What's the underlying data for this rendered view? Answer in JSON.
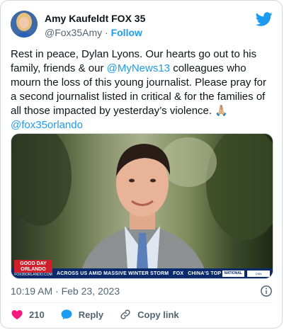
{
  "author": {
    "display_name": "Amy Kaufeldt FOX 35",
    "handle": "@Fox35Amy",
    "separator": "·",
    "follow_label": "Follow"
  },
  "tweet": {
    "text_part1": "Rest in peace, Dylan Lyons. Our hearts go out to his family, friends & our ",
    "mention1": "@MyNews13",
    "text_part2": " colleagues who mourn the loss of this young journalist. Please pray for a second journalist listed in critical & for the families of all those impacted by yesterday’s violence. 🙏🏼  ",
    "mention2": "@fox35orlando"
  },
  "media": {
    "badge_line1": "GOOD DAY",
    "badge_line2": "ORLANDO",
    "badge_url": "FOX35ORLANDO.COM",
    "ticker": "ACROSS US AMID MASSIVE WINTER STORM",
    "network": "FOX",
    "ticker2": "CHINA'S TOP",
    "national_badge": "NATIONAL",
    "corner_logo": "CNN NEWSOURCE"
  },
  "meta": {
    "timestamp": "10:19 AM · Feb 23, 2023"
  },
  "actions": {
    "like_count": "210",
    "reply_label": "Reply",
    "copy_link_label": "Copy link"
  },
  "colors": {
    "accent": "#1d9bf0",
    "like_red": "#f91880",
    "secondary_text": "#536471"
  },
  "icons": [
    "twitter-bird-icon",
    "info-icon",
    "heart-icon",
    "reply-icon",
    "link-icon"
  ]
}
